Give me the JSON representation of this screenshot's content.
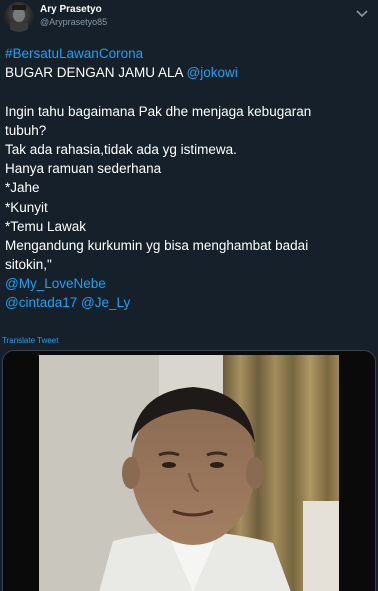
{
  "tweet": {
    "display_name": "Ary Prasetyo",
    "handle": "@Aryprasetyo85",
    "hashtag": "#BersatuLawanCorona",
    "headline_prefix": "BUGAR DENGAN JAMU ALA ",
    "headline_mention": "@jokowi",
    "body_lines": [
      "Ingin tahu bagaimana Pak dhe menjaga kebugaran",
      "tubuh?",
      "Tak ada rahasia,tidak ada yg istimewa.",
      "Hanya ramuan sederhana",
      "*Jahe",
      "*Kunyit",
      "*Temu Lawak",
      "Mengandung kurkumin yg bisa menghambat badai",
      "sitokin,\""
    ],
    "mention_1": "@My_LoveNebe",
    "mention_2": "@cintada17",
    "mention_3": "@Je_Ly",
    "translate_label": "Translate Tweet"
  },
  "icons": {
    "avatar": "avatar-image",
    "more": "chevron-down-icon"
  }
}
